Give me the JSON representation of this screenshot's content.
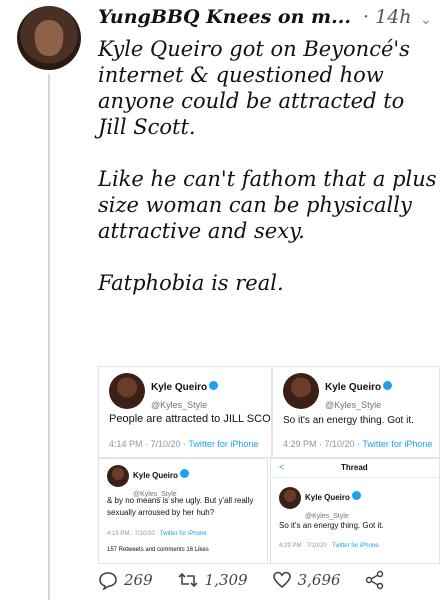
{
  "tweet": {
    "author": "YungBBQ Knees on m...",
    "separator": "·",
    "time": "14h",
    "paragraphs": [
      "Kyle Queiro got on Beyoncé's internet & questioned how anyone could be attracted to Jill Scott.",
      "Like he can't fathom that a plus size woman can be physically attractive and sexy.",
      "Fatphobia is real."
    ]
  },
  "screenshots": {
    "s1": {
      "name": "Kyle Queiro",
      "handle": "@Kyles_Style",
      "text": "People are attracted to JILL SCO",
      "time": "4:14 PM · 7/10/20 · ",
      "source": "Twitter for iPhone"
    },
    "s2": {
      "name": "Kyle Queiro",
      "handle": "@Kyles_Style",
      "text": "So it's an energy thing. Got it.",
      "time": "4:29 PM · 7/10/20 · ",
      "source": "Twitter for iPhone"
    },
    "s3": {
      "name": "Kyle Queiro",
      "handle": "@Kyles_Style",
      "text": "& by no means is she ugly. But y'all really sexually arroused by her huh?",
      "time": "4:15 PM · 7/10/20 · ",
      "source": "Twitter for iPhone",
      "stats": "157 Retweets and comments  16 Likes"
    },
    "s4": {
      "header": "Thread",
      "back": "<",
      "name": "Kyle Queiro",
      "handle": "@Kyles_Style",
      "text": "So it's an energy thing. Got it.",
      "time": "4:29 PM · 7/10/20 · ",
      "source": "Twitter for iPhone"
    }
  },
  "actions": {
    "replies": "269",
    "retweets": "1,309",
    "likes": "3,696"
  },
  "colors": {
    "link": "#1da1f2",
    "line": "#cfd9de"
  }
}
